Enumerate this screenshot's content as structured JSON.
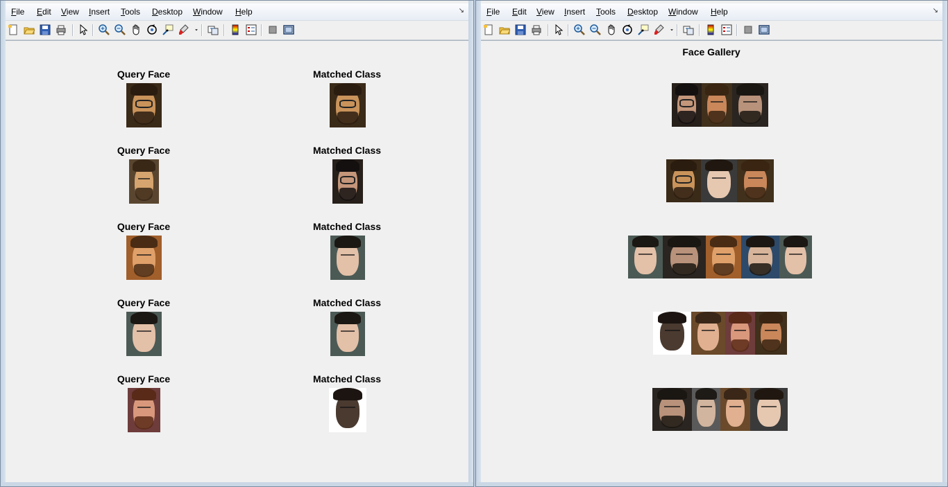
{
  "menu": [
    "File",
    "Edit",
    "View",
    "Insert",
    "Tools",
    "Desktop",
    "Window",
    "Help"
  ],
  "menu_underline": [
    "F",
    "E",
    "V",
    "I",
    "T",
    "D",
    "W",
    "H"
  ],
  "toolbar_icons": [
    "new-figure-icon",
    "open-file-icon",
    "save-icon",
    "print-icon",
    "edit-plot-arrow-icon",
    "zoom-in-icon",
    "zoom-out-icon",
    "pan-hand-icon",
    "rotate-3d-icon",
    "data-cursor-icon",
    "brush-icon",
    "brush-dropdown-icon",
    "link-plot-icon",
    "insert-colorbar-icon",
    "insert-legend-icon",
    "hide-plot-tools-icon",
    "show-plot-tools-icon"
  ],
  "left_figure": {
    "rows": [
      {
        "query_title": "Query Face",
        "match_title": "Matched Class"
      },
      {
        "query_title": "Query Face",
        "match_title": "Matched Class"
      },
      {
        "query_title": "Query Face",
        "match_title": "Matched Class"
      },
      {
        "query_title": "Query Face",
        "match_title": "Matched Class"
      },
      {
        "query_title": "Query Face",
        "match_title": "Matched Class"
      }
    ]
  },
  "right_figure": {
    "title": "Face Gallery",
    "gallery_rows": [
      3,
      3,
      5,
      4,
      4
    ]
  }
}
